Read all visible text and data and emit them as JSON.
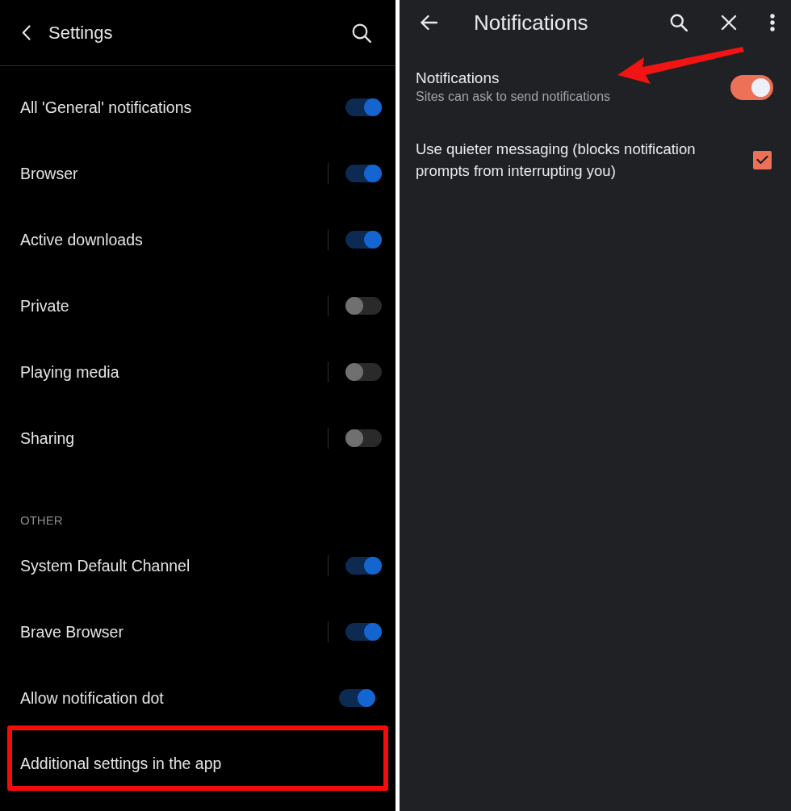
{
  "left_panel": {
    "title": "Settings",
    "sections": [
      {
        "items": [
          {
            "kind": "group_toggle",
            "label": "All 'General' notifications",
            "on": true
          },
          {
            "kind": "channel",
            "label": "Browser",
            "on": true
          },
          {
            "kind": "channel",
            "label": "Active downloads",
            "on": true
          },
          {
            "kind": "channel",
            "label": "Private",
            "on": false
          },
          {
            "kind": "channel",
            "label": "Playing media",
            "on": false
          },
          {
            "kind": "channel",
            "label": "Sharing",
            "on": false
          }
        ]
      },
      {
        "title": "OTHER",
        "items": [
          {
            "kind": "channel",
            "label": "System Default Channel",
            "on": true
          },
          {
            "kind": "channel",
            "label": "Brave Browser",
            "on": true
          },
          {
            "kind": "setting",
            "label": "Allow notification dot",
            "on": true
          }
        ]
      }
    ],
    "app_link": {
      "label": "Additional settings in the app",
      "highlighted": true
    }
  },
  "right_panel": {
    "title": "Notifications",
    "settings": [
      {
        "kind": "toggle",
        "title": "Notifications",
        "subtitle": "Sites can ask to send notifications",
        "on": true,
        "arrow": true
      },
      {
        "kind": "checkbox",
        "title": "Use quieter messaging (blocks notification prompts from interrupting you)",
        "checked": true,
        "arrow": false
      }
    ]
  }
}
